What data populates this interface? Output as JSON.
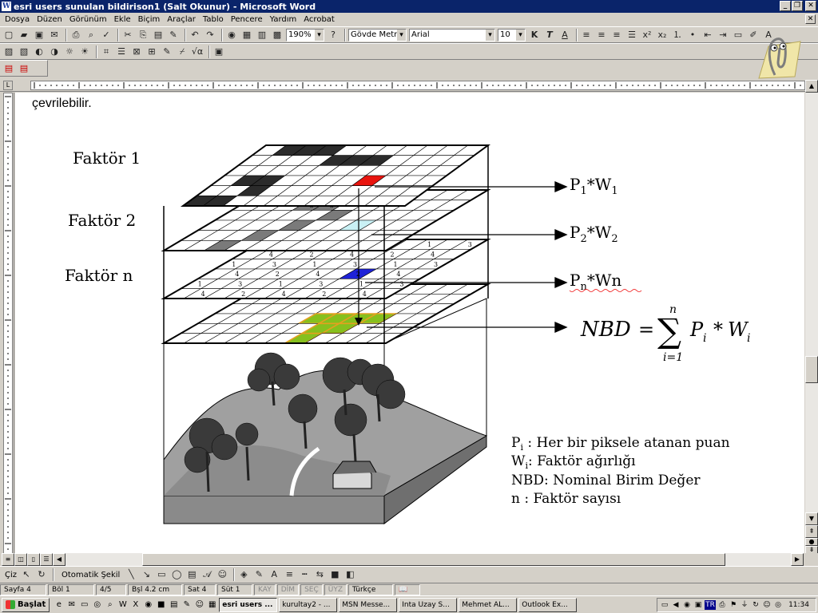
{
  "window": {
    "title": "esri users sunulan bildirison1 (Salt Okunur) - Microsoft Word"
  },
  "menu": [
    "Dosya",
    "Düzen",
    "Görünüm",
    "Ekle",
    "Biçim",
    "Araçlar",
    "Tablo",
    "Pencere",
    "Yardım",
    "Acrobat"
  ],
  "toolbar": {
    "zoom": "190%",
    "style": "Gövde Metni Gi",
    "font": "Arial",
    "font_size": "10",
    "bold": "K",
    "italic": "T",
    "underline": "A"
  },
  "document": {
    "line_top": "çevrilebilir.",
    "labels": {
      "factor1": "Faktör 1",
      "factor2": "Faktör 2",
      "factorn": "Faktör n"
    },
    "grid_numbers": [
      "1",
      "2",
      "3",
      "4"
    ],
    "formula": {
      "lhs": "NBD",
      "eq": "=",
      "sigma": "∑",
      "upper": "n",
      "lower": "i=1",
      "p": "P",
      "star": "*",
      "w": "W",
      "sub_i": "i"
    },
    "legend": [
      {
        "sym": "P",
        "sub": "i",
        "text": " : Her bir piksele atanan puan"
      },
      {
        "sym": "W",
        "sub": "i",
        "text": ": Faktör ağırlığı"
      },
      {
        "sym": "NBD",
        "sub": "",
        "text": ": Nominal Birim Değer"
      },
      {
        "sym": "n",
        "sub": "",
        "text": "  : Faktör sayısı"
      }
    ],
    "arrow_labels": [
      {
        "p": "P",
        "psub": "1",
        "star": "*",
        "w": "W",
        "wsub": "1"
      },
      {
        "p": "P",
        "psub": "2",
        "star": "*",
        "w": "W",
        "wsub": "2"
      },
      {
        "p": "P",
        "psub": "n",
        "star": "*",
        "w": "Wn",
        "wsub": ""
      }
    ],
    "colors": {
      "red_cell": "#e8140e",
      "cyan_cell": "#c9f1f5",
      "blue_cell": "#1e22d8",
      "green_cell": "#86c01e",
      "green_border": "#e3a020"
    }
  },
  "drawbar": {
    "draw": "Çiz",
    "autoshapes": "Otomatik Şekil"
  },
  "status": {
    "page": "Sayfa 4",
    "section": "Böl 1",
    "pages": "4/5",
    "at": "Bşl 4.2 cm",
    "line": "Sat 4",
    "col": "Süt 1",
    "rec": "KAY",
    "trk": "DİM",
    "ext": "SEÇ",
    "ovr": "ÜYZ",
    "lang": "Türkçe"
  },
  "taskbar": {
    "start": "Başlat",
    "tasks": [
      "esri users ...",
      "kurultay2 - ...",
      "MSN Messe...",
      "Inta Uzay S...",
      "Mehmet AL...",
      "Outlook Ex..."
    ],
    "clock": "11:34",
    "tray_lang": "TR"
  }
}
